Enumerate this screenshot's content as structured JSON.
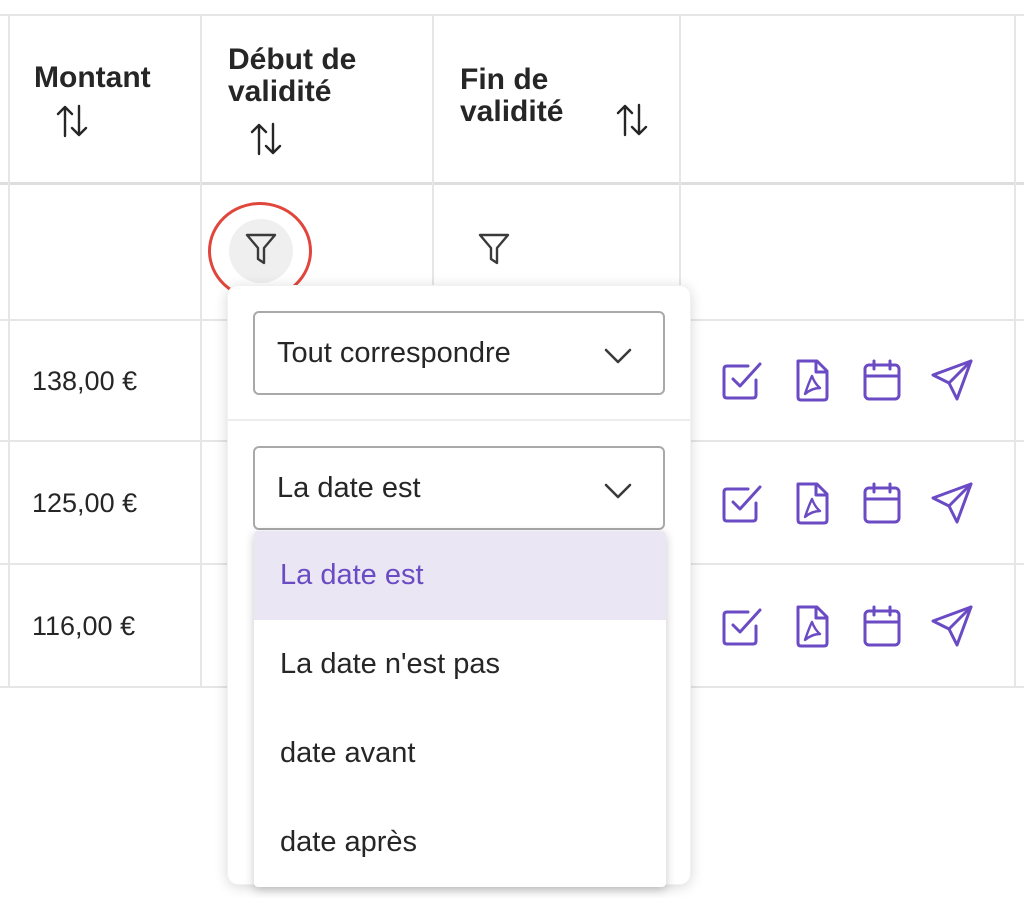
{
  "table": {
    "columns": [
      {
        "label": "Montant"
      },
      {
        "label_line1": "Début de",
        "label_line2": "validité"
      },
      {
        "label_line1": "Fin de",
        "label_line2": "validité"
      }
    ],
    "rows": [
      {
        "amount": "138,00 €"
      },
      {
        "amount": "125,00 €"
      },
      {
        "amount": "116,00 €"
      }
    ]
  },
  "filter_panel": {
    "match_select": {
      "value": "Tout correspondre"
    },
    "rule_select": {
      "value": "La date est"
    },
    "rule_options": [
      {
        "label": "La date est",
        "selected": true
      },
      {
        "label": "La date n'est pas",
        "selected": false
      },
      {
        "label": "date avant",
        "selected": false
      },
      {
        "label": "date après",
        "selected": false
      }
    ]
  },
  "icons": {
    "sort": "sort-arrows-icon",
    "filter": "funnel-icon",
    "row_actions": [
      "checkbox-icon",
      "pdf-file-icon",
      "calendar-icon",
      "send-icon"
    ]
  },
  "colors": {
    "accent": "#6a4bc4",
    "highlight_ring": "#e0463c",
    "selected_option_bg": "#ebe6f3"
  }
}
